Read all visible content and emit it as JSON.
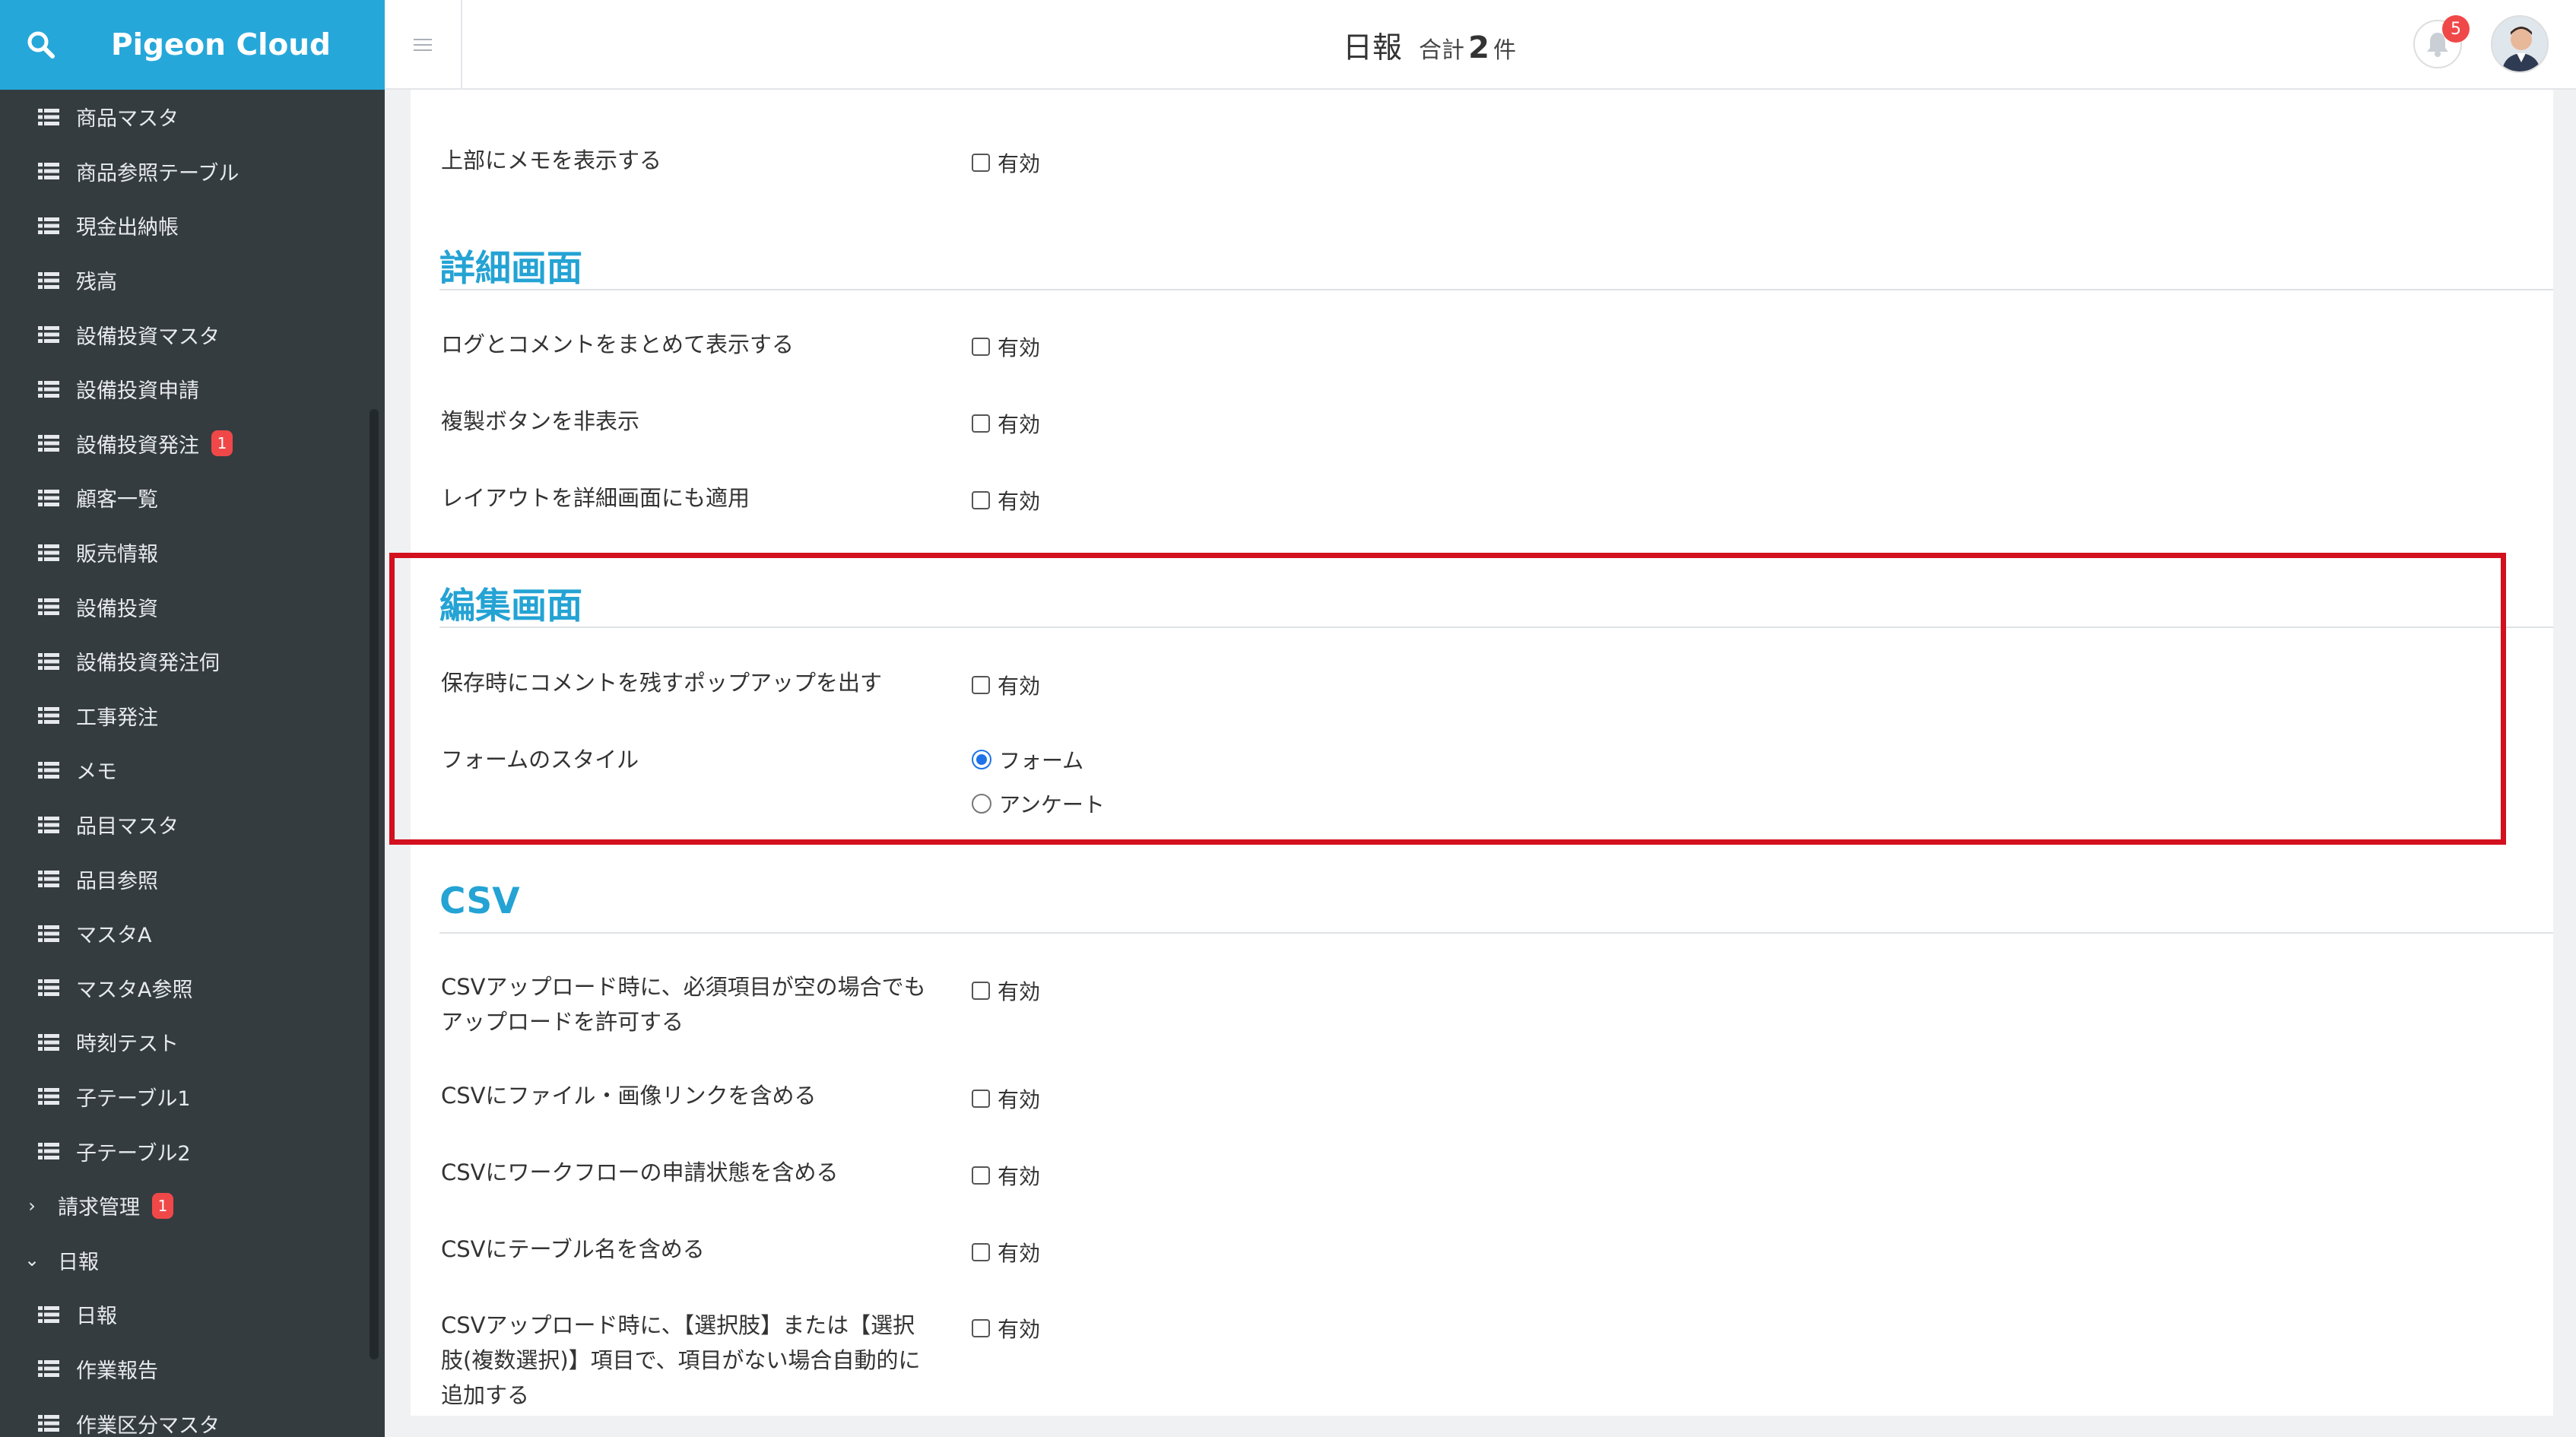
{
  "header": {
    "brand": "Pigeon Cloud",
    "page_title": "日報",
    "count_label": "合計",
    "count": "2",
    "count_unit": "件",
    "notification_count": "5"
  },
  "sidebar": {
    "items": [
      {
        "label": "商品マスタ"
      },
      {
        "label": "商品参照テーブル"
      },
      {
        "label": "現金出納帳"
      },
      {
        "label": "残高"
      },
      {
        "label": "設備投資マスタ"
      },
      {
        "label": "設備投資申請"
      },
      {
        "label": "設備投資発注",
        "badge": "1"
      },
      {
        "label": "顧客一覧"
      },
      {
        "label": "販売情報"
      },
      {
        "label": "設備投資"
      },
      {
        "label": "設備投資発注伺"
      },
      {
        "label": "工事発注"
      },
      {
        "label": "メモ"
      },
      {
        "label": "品目マスタ"
      },
      {
        "label": "品目参照"
      },
      {
        "label": "マスタA"
      },
      {
        "label": "マスタA参照"
      },
      {
        "label": "時刻テスト"
      },
      {
        "label": "子テーブル1"
      },
      {
        "label": "子テーブル2"
      }
    ],
    "group_billing": {
      "label": "請求管理",
      "badge": "1"
    },
    "group_daily": {
      "label": "日報"
    },
    "daily_items": [
      {
        "label": "日報"
      },
      {
        "label": "作業報告"
      },
      {
        "label": "作業区分マスタ"
      }
    ]
  },
  "main": {
    "enabled_label": "有効",
    "memo_row": {
      "label": "上部にメモを表示する"
    },
    "detail": {
      "title": "詳細画面",
      "rows": [
        {
          "label": "ログとコメントをまとめて表示する"
        },
        {
          "label": "複製ボタンを非表示"
        },
        {
          "label": "レイアウトを詳細画面にも適用"
        }
      ]
    },
    "edit": {
      "title": "編集画面",
      "comment_popup": "保存時にコメントを残すポップアップを出す",
      "form_style_label": "フォームのスタイル",
      "form_style_options": [
        "フォーム",
        "アンケート"
      ],
      "form_style_selected": "フォーム"
    },
    "csv": {
      "title": "CSV",
      "rows": [
        {
          "label_line1": "CSVアップロード時に、必須項目が空の場合でも",
          "label_line2": "アップロードを許可する"
        },
        {
          "label_line1": "CSVにファイル・画像リンクを含める"
        },
        {
          "label_line1": "CSVにワークフローの申請状態を含める"
        },
        {
          "label_line1": "CSVにテーブル名を含める"
        },
        {
          "label_line1": "CSVアップロード時に、【選択肢】または【選択",
          "label_line2": "肢(複数選択)】項目で、項目がない場合自動的に",
          "label_line3": "追加する"
        }
      ]
    }
  },
  "colors": {
    "brand": "#26a7d9",
    "sidebar": "#353c40",
    "section_title": "#24a3d4",
    "highlight_border": "#d3101e",
    "badge": "#f04848"
  }
}
